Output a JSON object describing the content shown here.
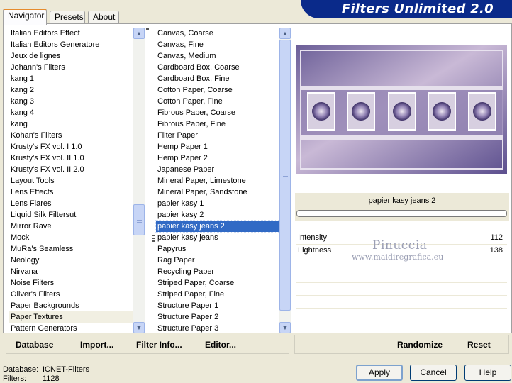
{
  "tabs": [
    {
      "label": "Navigator",
      "active": true
    },
    {
      "label": "Presets",
      "active": false
    },
    {
      "label": "About",
      "active": false
    }
  ],
  "title": "Filters Unlimited 2.0",
  "categories": [
    "Italian Editors Effect",
    "Italian Editors Generatore",
    "Jeux de lignes",
    "Johann's Filters",
    "kang 1",
    "kang 2",
    "kang 3",
    "kang 4",
    "kang",
    "Kohan's Filters",
    "Krusty's FX vol. I 1.0",
    "Krusty's FX vol. II 1.0",
    "Krusty's FX vol. II 2.0",
    "Layout Tools",
    "Lens Effects",
    "Lens Flares",
    "Liquid Silk Filtersut",
    "Mirror Rave",
    "Mock",
    "MuRa's Seamless",
    "Neology",
    "Nirvana",
    "Noise Filters",
    "Oliver's Filters",
    "Paper Backgrounds",
    "Paper Textures",
    "Pattern Generators"
  ],
  "categories_highlighted": "Paper Textures",
  "filters": [
    "Canvas, Coarse",
    "Canvas, Fine",
    "Canvas, Medium",
    "Cardboard Box, Coarse",
    "Cardboard Box, Fine",
    "Cotton Paper, Coarse",
    "Cotton Paper, Fine",
    "Fibrous Paper, Coarse",
    "Fibrous Paper, Fine",
    "Filter Paper",
    "Hemp Paper 1",
    "Hemp Paper 2",
    "Japanese Paper",
    "Mineral Paper, Limestone",
    "Mineral Paper, Sandstone",
    "papier kasy 1",
    "papier kasy 2",
    "papier kasy jeans 2",
    "papier kasy jeans",
    "Papyrus",
    "Rag Paper",
    "Recycling Paper",
    "Striped Paper, Coarse",
    "Striped Paper, Fine",
    "Structure Paper 1",
    "Structure Paper 2",
    "Structure Paper 3"
  ],
  "filters_selected": "papier kasy jeans 2",
  "preview": {
    "filter_name": "papier kasy jeans 2",
    "progress": 0
  },
  "parameters": [
    {
      "label": "Intensity",
      "value": "112"
    },
    {
      "label": "Lightness",
      "value": "138"
    }
  ],
  "watermark": {
    "line1": "Pinuccia",
    "line2": "www.maidiregrafica.eu"
  },
  "toolbar": {
    "database": "Database",
    "import": "Import...",
    "filter_info": "Filter Info...",
    "editor": "Editor...",
    "randomize": "Randomize",
    "reset": "Reset"
  },
  "status": {
    "database_label": "Database:",
    "database_value": "ICNET-Filters",
    "filters_label": "Filters:",
    "filters_value": "1128"
  },
  "buttons": {
    "apply": "Apply",
    "cancel": "Cancel",
    "help": "Help"
  },
  "colors": {
    "accent": "#316ac5",
    "banner": "#0a2a8a",
    "tab_accent": "#e68b2c"
  }
}
